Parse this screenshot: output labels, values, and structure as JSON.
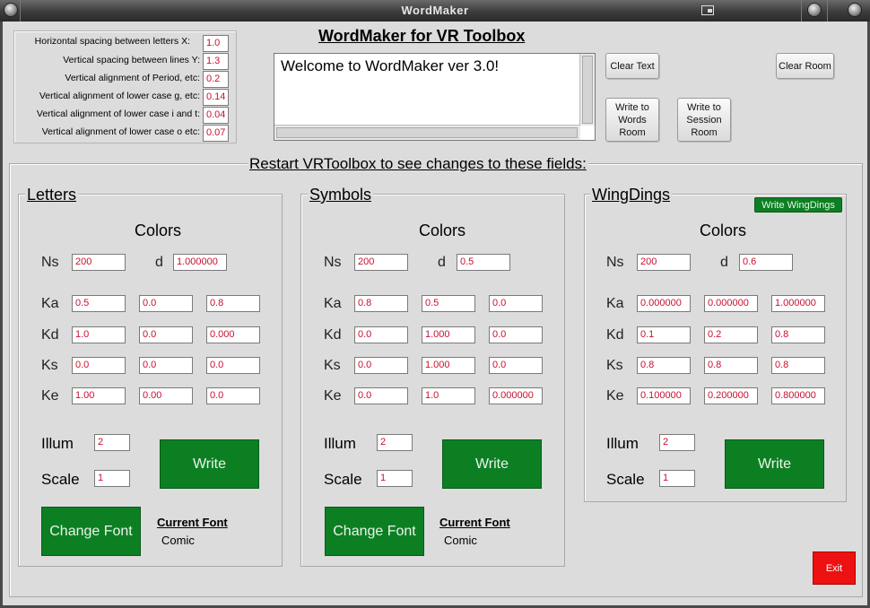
{
  "window": {
    "title": "WordMaker"
  },
  "header": {
    "title": "WordMaker for VR Toolbox"
  },
  "settings": [
    {
      "label": "Horizontal spacing between letters  X:",
      "value": "1.0"
    },
    {
      "label": "Vertical spacing between lines  Y:",
      "value": "1.3"
    },
    {
      "label": "Vertical alignment of Period, etc:",
      "value": "0.2"
    },
    {
      "label": "Vertical alignment of lower case g, etc:",
      "value": "0.14"
    },
    {
      "label": "Vertical alignment of lower case i and t:",
      "value": "0.04"
    },
    {
      "label": "Vertical alignment of lower case o etc:",
      "value": "0.07"
    }
  ],
  "textbox": {
    "text": "Welcome to WordMaker ver 3.0!"
  },
  "buttons": {
    "clear_text": "Clear Text",
    "clear_room": "Clear Room",
    "write_words_room": [
      "Write to",
      "Words",
      "Room"
    ],
    "write_session_room": [
      "Write to",
      "Session",
      "Room"
    ],
    "exit": "Exit",
    "write_wingdings": "Write WingDings"
  },
  "restart_note": "Restart VRToolbox to see changes to these fields:",
  "labels": {
    "colors": "Colors",
    "ns": "Ns",
    "d": "d",
    "ka": "Ka",
    "kd": "Kd",
    "ks": "Ks",
    "ke": "Ke",
    "illum": "Illum",
    "scale": "Scale",
    "write": "Write",
    "change_font": "Change Font",
    "current_font": "Current Font"
  },
  "groups": [
    {
      "title": "Letters",
      "ns": "200",
      "d": "1.000000",
      "ka": [
        "0.5",
        "0.0",
        "0.8"
      ],
      "kd": [
        "1.0",
        "0.0",
        "0.000"
      ],
      "ks": [
        "0.0",
        "0.0",
        "0.0"
      ],
      "ke": [
        "1.00",
        "0.00",
        "0.0"
      ],
      "illum": "2",
      "scale": "1",
      "font": "Comic"
    },
    {
      "title": "Symbols",
      "ns": "200",
      "d": "0.5",
      "ka": [
        "0.8",
        "0.5",
        "0.0"
      ],
      "kd": [
        "0.0",
        "1.000",
        "0.0"
      ],
      "ks": [
        "0.0",
        "1.000",
        "0.0"
      ],
      "ke": [
        "0.0",
        "1.0",
        "0.000000"
      ],
      "illum": "2",
      "scale": "1",
      "font": "Comic"
    },
    {
      "title": "WingDings",
      "ns": "200",
      "d": "0.6",
      "ka": [
        "0.000000",
        "0.000000",
        "1.000000"
      ],
      "kd": [
        "0.1",
        "0.2",
        "0.8"
      ],
      "ks": [
        "0.8",
        "0.8",
        "0.8"
      ],
      "ke": [
        "0.100000",
        "0.200000",
        "0.800000"
      ],
      "illum": "2",
      "scale": "1"
    }
  ]
}
